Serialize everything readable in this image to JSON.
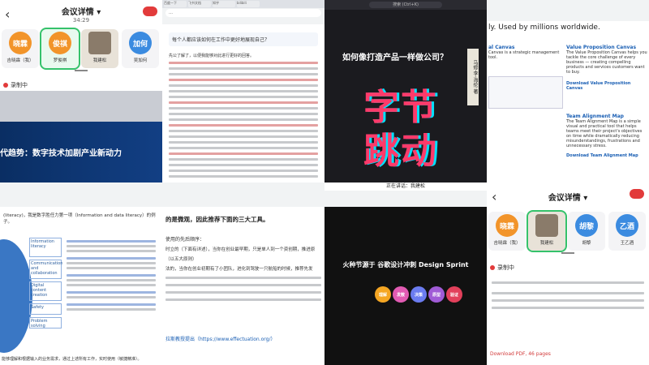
{
  "meeting_top": {
    "title": "会议详情 ▾",
    "time": "34:29",
    "participants": [
      {
        "avatar": "晓霖",
        "name": "吉晓霖（我）",
        "color": "#f2942a"
      },
      {
        "avatar": "俊祺",
        "name": "罗俊祺",
        "color": "#f2942a"
      },
      {
        "avatar": "",
        "name": "我建松",
        "color": "#8a7b6a"
      },
      {
        "avatar": "加何",
        "name": "吴加何",
        "color": "#3b8be0"
      }
    ],
    "recording": "录制中"
  },
  "doc_browser": {
    "url": "…",
    "tabs": [
      "百度一下",
      "飞书文档",
      "知乎",
      "bilibili"
    ],
    "question": "每个人都应该如何在工作中更好地展现自己？",
    "intro": "先公了解了，以便我能够对此进行更好的回答。"
  },
  "bytedance_book": {
    "search": "搜索 (Ctrl+K)",
    "headline": "如何像打造产品一样做公司？",
    "big1": "字节",
    "big2": "跳动",
    "side": "马修·李·海伦 著"
  },
  "canvas_site": {
    "tagline": "ly. Used by millions worldwide.",
    "items": [
      {
        "title": "al Canvas",
        "desc": "Canvas is a strategic management tool."
      },
      {
        "title": "Value Proposition Canvas",
        "desc": "The Value Proposition Canvas helps you tackle the core challenge of every business — creating compelling products and services customers want to buy."
      },
      {
        "title": "Download Value Proposition Canvas",
        "desc": ""
      },
      {
        "title": "Team Alignment Map",
        "desc": "The Team Alignment Map is a simple visual and practical tool that helps teams meet their project's objectives on time while dramatically reducing misunderstandings, frustrations and unnecessary stress."
      },
      {
        "title": "Download Team Alignment Map",
        "desc": ""
      }
    ],
    "download": "Download PDF, 46 pages"
  },
  "slide_banner": {
    "title": "代趋势：数字技术加剧产业新动力"
  },
  "framework": {
    "left_text": "(literacy)，我是数字胜任力第一项（Information and data literacy）的例子。",
    "boxes": [
      "Information literacy",
      "Communication and collaboration",
      "Digital content creation",
      "Safety",
      "Problem solving"
    ],
    "footer": "能够理解和根据输入的业务需求，通过上述所有工作，实时使用（敏捷精准）。"
  },
  "notes_doc": {
    "heading": "的是微观，因此推荐下面的三大工具。",
    "rec": "使用的先后顺序：",
    "bullet1": "时立的（下面有详述），当你在创业最早期，只是单人到一个资创期，推进原",
    "bullet2": "（以五大原则）",
    "bullet3": "法的，当你在创业初期有了小团队，进化到驾驶一只航船的时候，推荐先发",
    "link": "拉斯教授提出（https://www.effectuation.org/）"
  },
  "fire_slide": {
    "banner": "正在讲话：我建松",
    "title": "火种节源于 谷歌设计冲刺 Design Sprint",
    "steps": [
      "理解",
      "发散",
      "决策",
      "原型",
      "验证"
    ]
  },
  "meeting_bottom": {
    "title": "会议详情 ▾",
    "participants": [
      {
        "avatar": "晓霖",
        "name": "吉晓霖（我）",
        "color": "#f2942a"
      },
      {
        "avatar": "",
        "name": "我建松",
        "color": "#8a7b6a"
      },
      {
        "avatar": "胡黎",
        "name": "胡黎",
        "color": "#3b8be0"
      },
      {
        "avatar": "乙酒",
        "name": "王乙酒",
        "color": "#3b8be0"
      }
    ],
    "recording": "录制中"
  }
}
